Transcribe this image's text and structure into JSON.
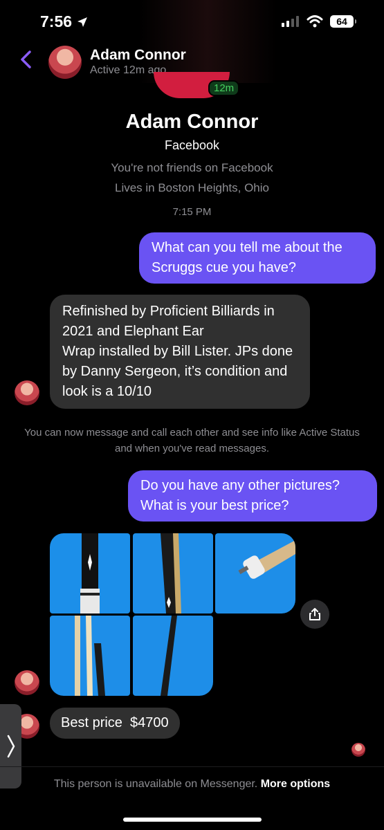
{
  "status_bar": {
    "time": "7:56",
    "battery": "64"
  },
  "header": {
    "name": "Adam Connor",
    "status": "Active 12m ago"
  },
  "profile": {
    "active_badge": "12m",
    "name": "Adam Connor",
    "platform": "Facebook",
    "friend_status": "You're not friends on Facebook",
    "location": "Lives in Boston Heights, Ohio"
  },
  "timestamp": "7:15 PM",
  "messages": [
    {
      "from": "me",
      "text": "What can you tell me about the Scruggs cue you have?"
    },
    {
      "from": "them",
      "text": "Refinished by Proficient Billiards in 2021 and Elephant Ear\nWrap installed by Bill Lister. JPs done by Danny Sergeon, it’s condition and look is a 10/10"
    },
    {
      "from": "me",
      "text": "Do you have any other pictures? What is your best price?"
    },
    {
      "from": "them",
      "text": "Best price  $4700"
    }
  ],
  "system_note": "You can now message and call each other and see info like Active Status and when you've read messages.",
  "footer": {
    "text": "This person is unavailable on Messenger.",
    "link": "More options"
  },
  "colors": {
    "accent": "#6a53f3",
    "incoming": "#303030",
    "back_arrow": "#8b5cf6"
  }
}
